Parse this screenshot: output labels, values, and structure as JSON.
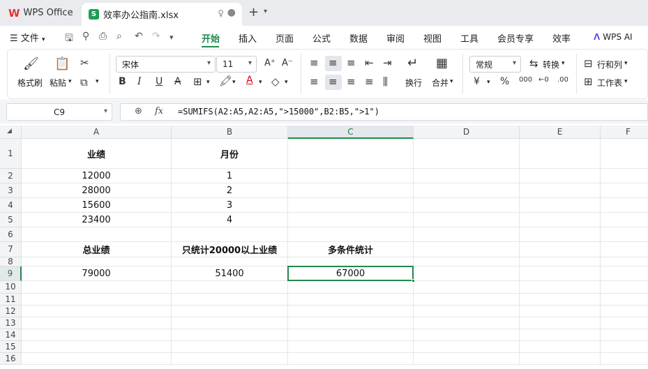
{
  "tabs": {
    "app_label": "WPS Office",
    "file_label": "效率办公指南.xlsx",
    "file_icon_letter": "S"
  },
  "menu": {
    "file_label": "文件",
    "tabs": [
      {
        "label": "开始",
        "active": true
      },
      {
        "label": "插入"
      },
      {
        "label": "页面"
      },
      {
        "label": "公式"
      },
      {
        "label": "数据"
      },
      {
        "label": "审阅"
      },
      {
        "label": "视图"
      },
      {
        "label": "工具"
      },
      {
        "label": "会员专享"
      },
      {
        "label": "效率"
      }
    ],
    "ai_label": "WPS AI"
  },
  "ribbon": {
    "format_painter": "格式刷",
    "paste": "粘贴",
    "font_name": "宋体",
    "font_size": "11",
    "wrap": "换行",
    "merge": "合并",
    "number_format": "常规",
    "convert": "转换",
    "rows_cols": "行和列",
    "worksheet": "工作表"
  },
  "formula_bar": {
    "name_box": "C9",
    "formula": "=SUMIFS(A2:A5,A2:A5,\">15000\",B2:B5,\">1\")"
  },
  "sheet": {
    "columns": [
      "A",
      "B",
      "C",
      "D",
      "E",
      "F"
    ],
    "rows": [
      "1",
      "2",
      "3",
      "4",
      "5",
      "6",
      "7",
      "8",
      "9",
      "10",
      "11",
      "12",
      "13",
      "14",
      "15",
      "16"
    ],
    "cells": {
      "A1": "业绩",
      "B1": "月份",
      "A2": "12000",
      "B2": "1",
      "A3": "28000",
      "B3": "2",
      "A4": "15600",
      "B4": "3",
      "A5": "23400",
      "B5": "4",
      "A7": "总业绩",
      "B7": "只统计20000以上业绩",
      "C7": "多条件统计",
      "A9": "79000",
      "B9": "51400",
      "C9": "67000"
    },
    "selected_cell": "C9",
    "selected_column": "C",
    "selected_row": "9",
    "accent_color": "#1f8a4c"
  }
}
